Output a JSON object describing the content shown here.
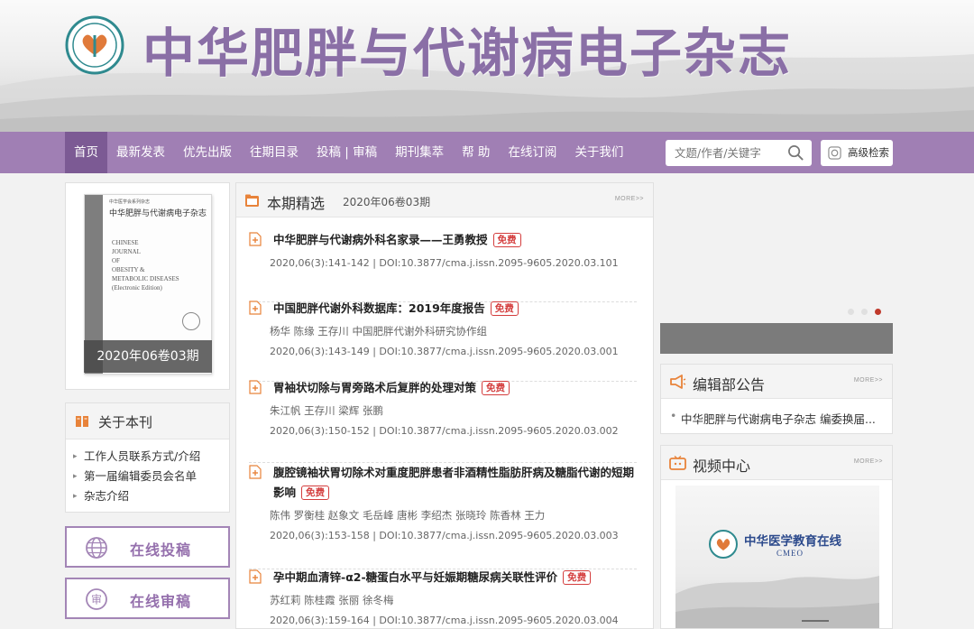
{
  "site": {
    "title": "中华肥胖与代谢病电子杂志"
  },
  "nav": {
    "items": [
      "首页",
      "最新发表",
      "优先出版",
      "往期目录",
      "投稿 | 审稿",
      "期刊集萃",
      "帮 助",
      "在线订阅",
      "关于我们"
    ],
    "active_index": 0
  },
  "search": {
    "placeholder": "文题/作者/关键字",
    "advanced_label": "高级检索"
  },
  "cover": {
    "top_line": "中华医学会系列杂志",
    "title": "中华肥胖与代谢病电子杂志",
    "en_lines": [
      "CHINESE",
      "JOURNAL",
      "OF",
      "OBESITY &",
      "METABOLIC DISEASES",
      "(Electronic Edition)"
    ],
    "caption": "2020年06卷03期"
  },
  "about": {
    "title": "关于本刊",
    "items": [
      "工作人员联系方式/介绍",
      "第一届编辑委员会名单",
      "杂志介绍"
    ]
  },
  "actions": {
    "submit_label": "在线投稿",
    "review_label": "在线审稿"
  },
  "featured": {
    "title": "本期精选",
    "issue": "2020年06卷03期",
    "more": "MORE>>",
    "free_label": "免费",
    "articles": [
      {
        "title": "中华肥胖与代谢病外科名家录——王勇教授",
        "authors": "",
        "meta": "2020,06(3):141-142 | DOI:10.3877/cma.j.issn.2095-9605.2020.03.101"
      },
      {
        "title": "中国肥胖代谢外科数据库：2019年度报告",
        "authors": "杨华 陈缘 王存川 中国肥胖代谢外科研究协作组",
        "meta": "2020,06(3):143-149 | DOI:10.3877/cma.j.issn.2095-9605.2020.03.001"
      },
      {
        "title": "胃袖状切除与胃旁路术后复胖的处理对策",
        "authors": "朱江帆 王存川 梁辉 张鹏",
        "meta": "2020,06(3):150-152 | DOI:10.3877/cma.j.issn.2095-9605.2020.03.002"
      },
      {
        "title": "腹腔镜袖状胃切除术对重度肥胖患者非酒精性脂肪肝病及糖脂代谢的短期影响",
        "authors": "陈伟 罗衡桂 赵象文 毛岳峰 唐彬 李绍杰 张晓玲 陈香林 王力",
        "meta": "2020,06(3):153-158 | DOI:10.3877/cma.j.issn.2095-9605.2020.03.003"
      },
      {
        "title": "孕中期血清锌-α2-糖蛋白水平与妊娠期糖尿病关联性评价",
        "authors": "苏红莉 陈桂霞 张丽 徐冬梅",
        "meta": "2020,06(3):159-164 | DOI:10.3877/cma.j.issn.2095-9605.2020.03.004"
      }
    ]
  },
  "notice": {
    "title": "编辑部公告",
    "more": "MORE>>",
    "item": "中华肥胖与代谢病电子杂志 编委换届..."
  },
  "video": {
    "title": "视频中心",
    "more": "MORE>>",
    "thumb_title": "中华医学教育在线",
    "thumb_sub": "CMEO"
  },
  "colors": {
    "nav_bg": "#a07fb4",
    "nav_active": "#7c5a94",
    "title_purple": "#8a6fa6",
    "free_red": "#d43d3d",
    "accent_orange": "#e8833a"
  }
}
